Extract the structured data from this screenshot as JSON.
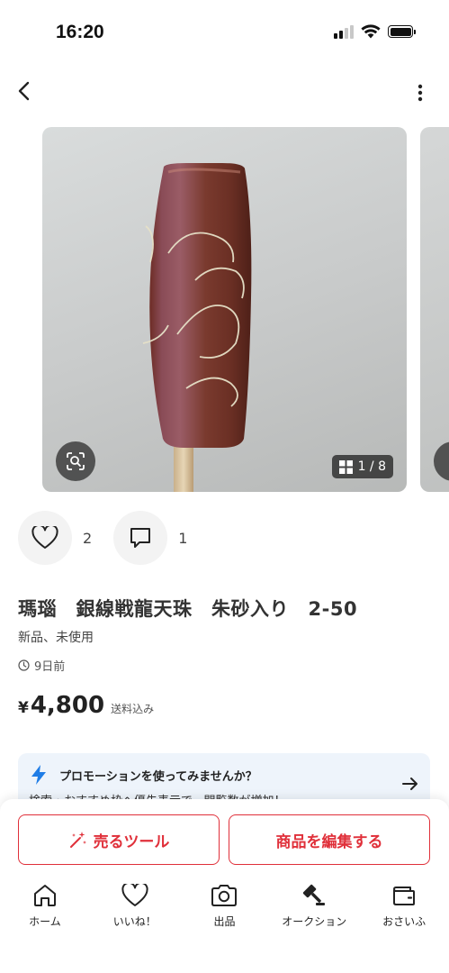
{
  "status_bar": {
    "time": "16:20"
  },
  "gallery": {
    "counter": "1 / 8"
  },
  "reactions": {
    "likes": "2",
    "comments": "1"
  },
  "item": {
    "title": "瑪瑙　銀線戦龍天珠　朱砂入り　2-50",
    "condition": "新品、未使用",
    "posted": "9日前",
    "price_symbol": "¥",
    "price": "4,800",
    "shipping": "送料込み"
  },
  "promo": {
    "title": "プロモーションを使ってみませんか？",
    "subtitle": "検索・おすすめ枠へ優先表示で、閲覧数が増加！"
  },
  "actions": {
    "sell_tool": "売るツール",
    "edit_item": "商品を編集する"
  },
  "tabs": [
    {
      "label": "ホーム",
      "icon": "home-icon"
    },
    {
      "label": "いいね！",
      "icon": "heart-icon"
    },
    {
      "label": "出品",
      "icon": "camera-icon"
    },
    {
      "label": "オークション",
      "icon": "gavel-icon"
    },
    {
      "label": "おさいふ",
      "icon": "wallet-icon"
    }
  ],
  "colors": {
    "accent": "#e0303a",
    "promo_bg": "#eef4fb",
    "bolt": "#1f7de6"
  }
}
